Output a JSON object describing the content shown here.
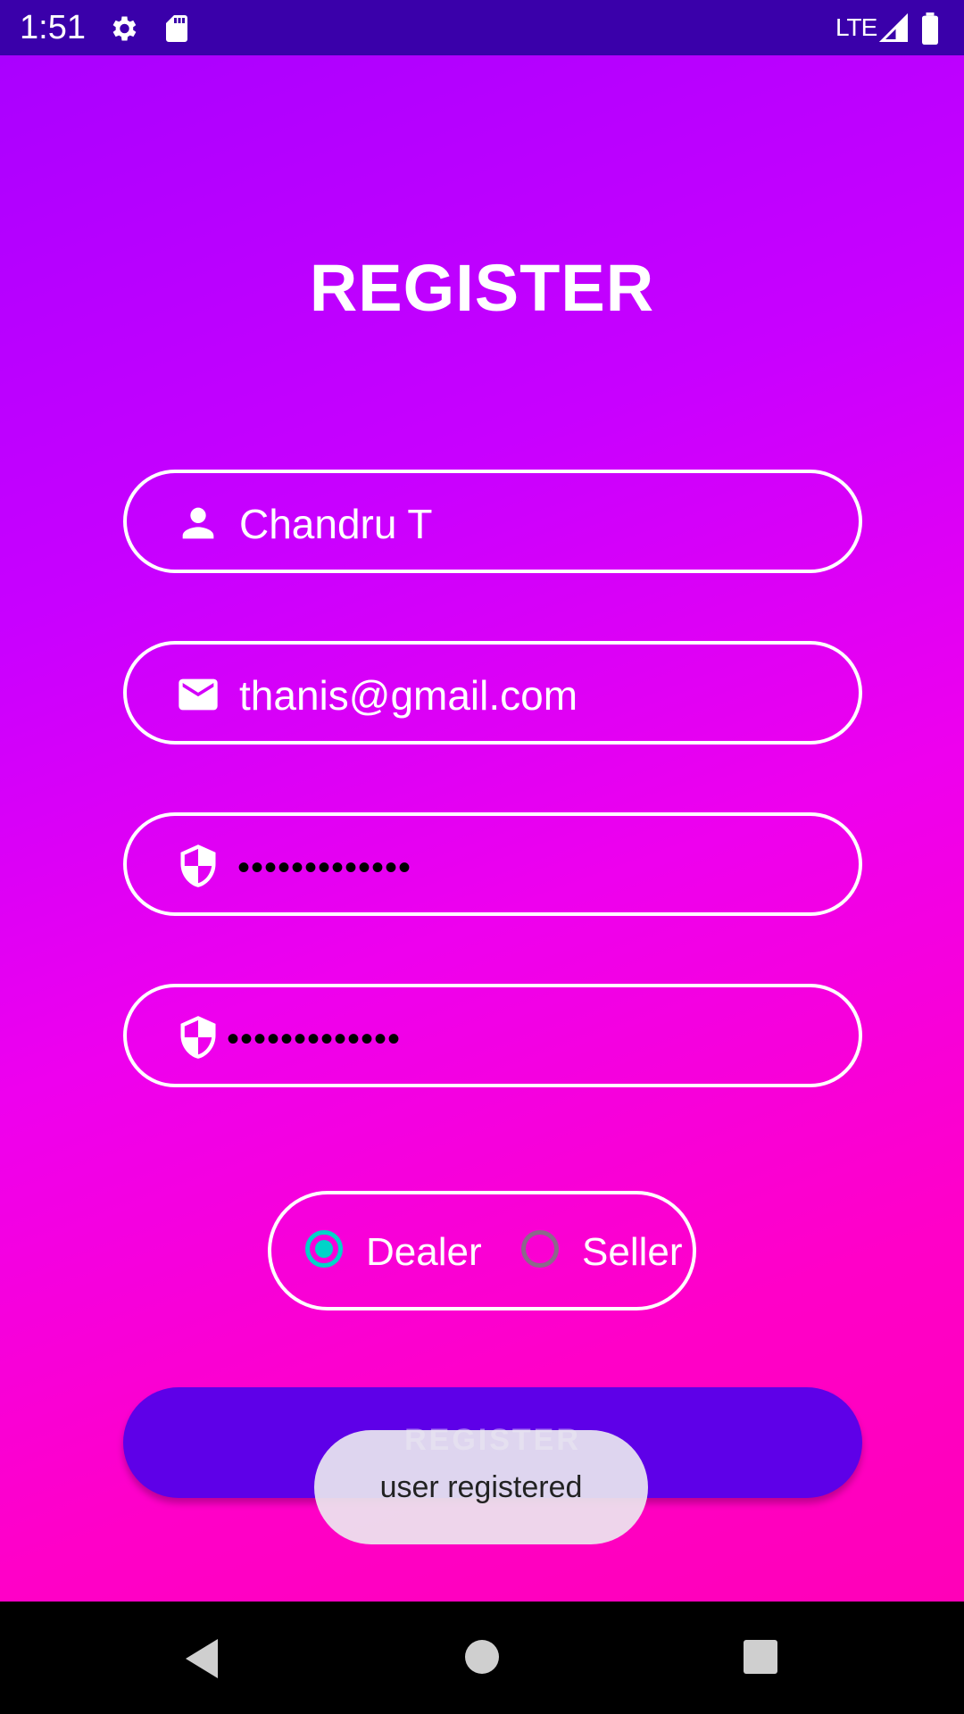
{
  "status_bar": {
    "time": "1:51",
    "network": "LTE",
    "icons": [
      "gear-icon",
      "sd-card-icon",
      "signal-icon",
      "battery-icon"
    ]
  },
  "screen": {
    "title": "REGISTER",
    "fields": {
      "name": {
        "value": "Chandru T",
        "icon": "person-icon"
      },
      "email": {
        "value": "thanis@gmail.com",
        "icon": "mail-icon"
      },
      "password": {
        "value": "•••••••••••••",
        "icon": "shield-icon"
      },
      "confirm_password": {
        "value": "•••••••••••••",
        "icon": "shield-icon"
      }
    },
    "role": {
      "options": [
        "Dealer",
        "Seller"
      ],
      "selected": "Dealer"
    },
    "register_button": "REGISTER"
  },
  "toast": {
    "message": "user registered"
  },
  "nav_bar": {
    "icons": [
      "back-icon",
      "home-icon",
      "recents-icon"
    ]
  },
  "colors": {
    "status_bar": "#3a00aa",
    "gradient_top": "#aa00ff",
    "gradient_bottom": "#ff00b8",
    "button": "#5e00e8",
    "radio_accent": "#00d4c8"
  }
}
